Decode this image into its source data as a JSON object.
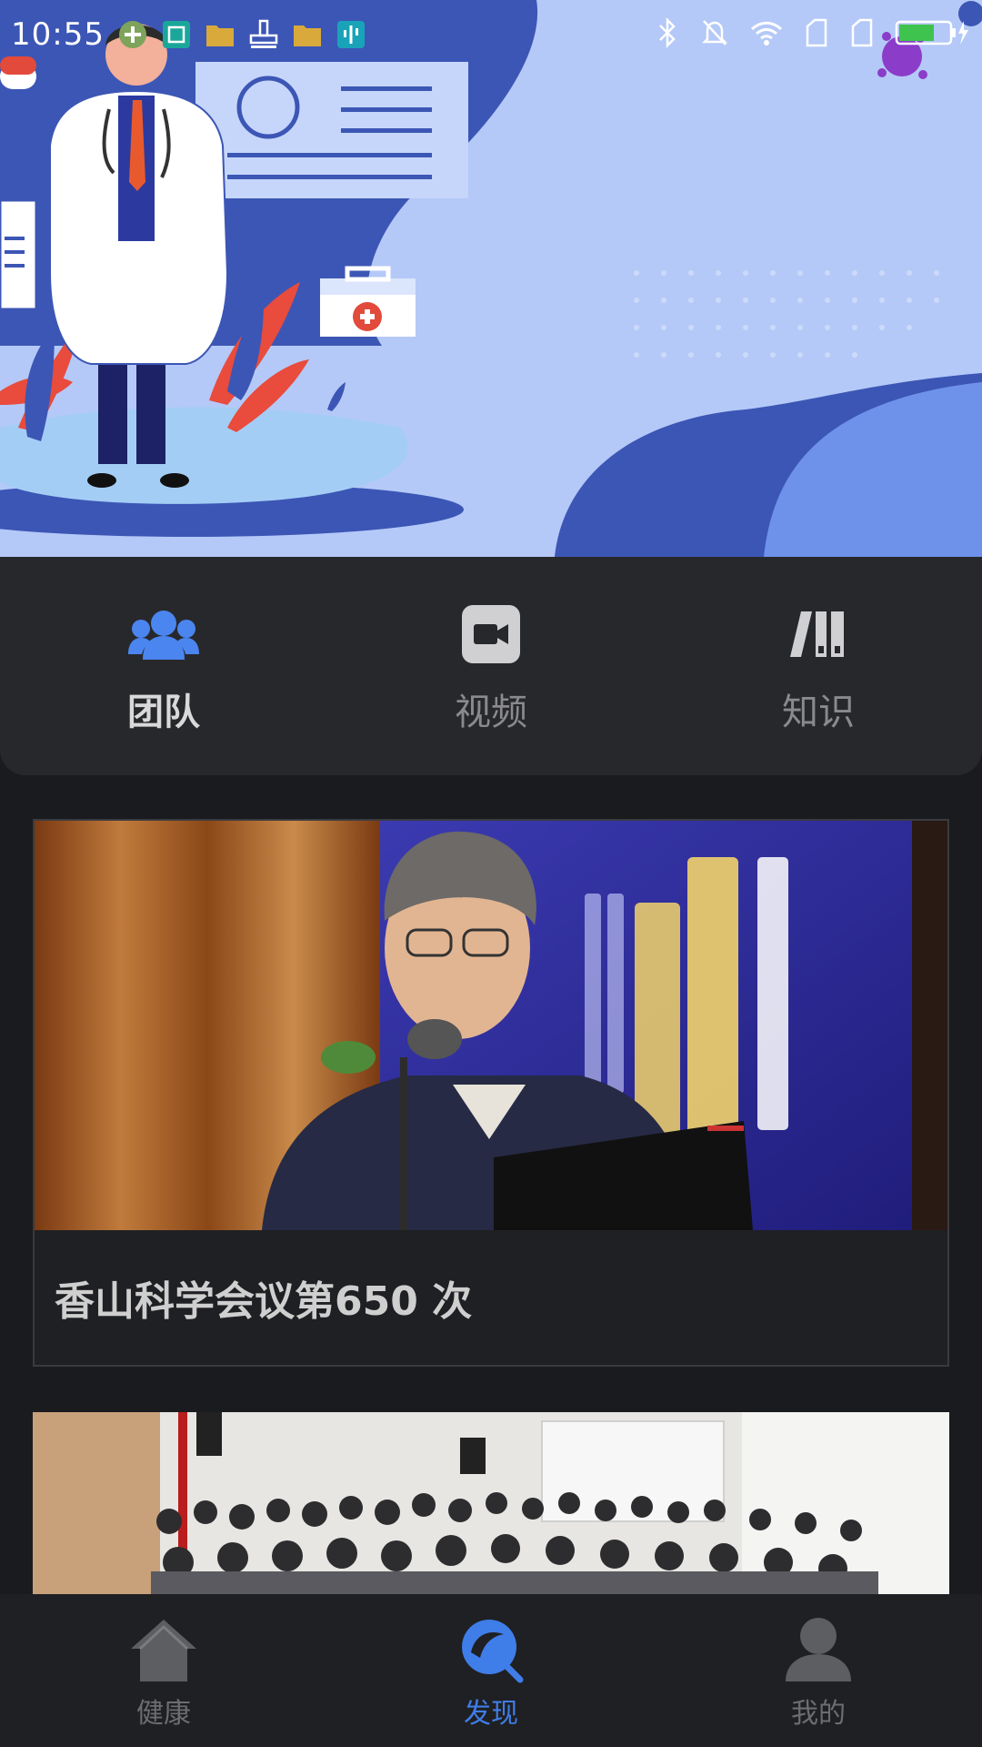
{
  "status_bar": {
    "time": "10:55",
    "notification_icons": [
      "add-circle-icon",
      "screenshot-icon",
      "folder-icon",
      "stamp-icon",
      "folder-icon",
      "usb-icon"
    ],
    "system_icons": [
      "bluetooth-icon",
      "bell-off-icon",
      "wifi-icon",
      "sim-icon",
      "sim-icon",
      "battery-charging-icon"
    ]
  },
  "tabs": [
    {
      "label": "团队",
      "icon": "team-icon",
      "active": true
    },
    {
      "label": "视频",
      "icon": "video-icon",
      "active": false
    },
    {
      "label": "知识",
      "icon": "books-icon",
      "active": false
    }
  ],
  "feed": [
    {
      "caption": "香山科学会议第650 次"
    }
  ],
  "bottom_nav": [
    {
      "label": "健康",
      "icon": "home-icon",
      "active": false
    },
    {
      "label": "发现",
      "icon": "discover-icon",
      "active": true
    },
    {
      "label": "我的",
      "icon": "profile-icon",
      "active": false
    }
  ],
  "colors": {
    "accent": "#3f7de8",
    "background": "#1a1b1e",
    "card": "#27282c",
    "hero_bg": "#b4c9f7"
  }
}
